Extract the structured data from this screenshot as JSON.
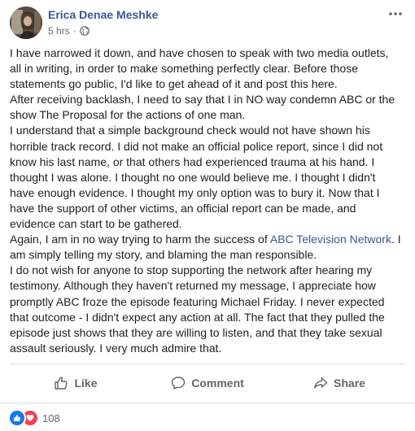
{
  "post": {
    "author": "Erica Denae Meshke",
    "time": "5 hrs",
    "separator": "·"
  },
  "body": {
    "lines": [
      "I have narrowed it down, and have chosen to speak with two media outlets,",
      "all in writing, in order to make something perfectly clear. Before those",
      "statements go public, I'd like to get ahead of it and post this here.",
      "After receiving backlash, I need to say that I in NO way condemn ABC or the",
      "show The Proposal for the actions of one man.",
      "I understand that a simple background check would not have shown his",
      "horrible track record. I did not make an official police report, since I did not",
      "know his last name, or that others had experienced trauma at his hand. I",
      "thought I was alone. I thought no one would believe me. I thought I didn't",
      "have enough evidence. I thought my only option was to bury it. Now that I",
      "have the support of other victims, an official report can be made, and",
      "evidence can start to be gathered."
    ],
    "line_again_before": "Again, I am in no way trying to harm the success of ",
    "link": "ABC Television Network",
    "line_again_after": ". I",
    "lines_after": [
      "am simply telling my story, and blaming the man responsible.",
      "I do not wish for anyone to stop supporting the network after hearing my",
      "testimony. Although they haven't returned my message, I appreciate how",
      "promptly ABC froze the episode featuring Michael Friday. I never expected",
      "that outcome - I didn't expect any action at all. The fact that they pulled the",
      "episode just shows that they are willing to listen, and that they take sexual",
      "assault seriously. I very much admire that."
    ]
  },
  "actions": {
    "like": "Like",
    "comment": "Comment",
    "share": "Share"
  },
  "reactions": {
    "count": "108",
    "types": [
      "like-icon",
      "love-icon"
    ]
  },
  "colors": {
    "author": "#385898",
    "like_blue": "#1877f2",
    "love_red": "#f33e58",
    "secondary_text": "#606770"
  }
}
